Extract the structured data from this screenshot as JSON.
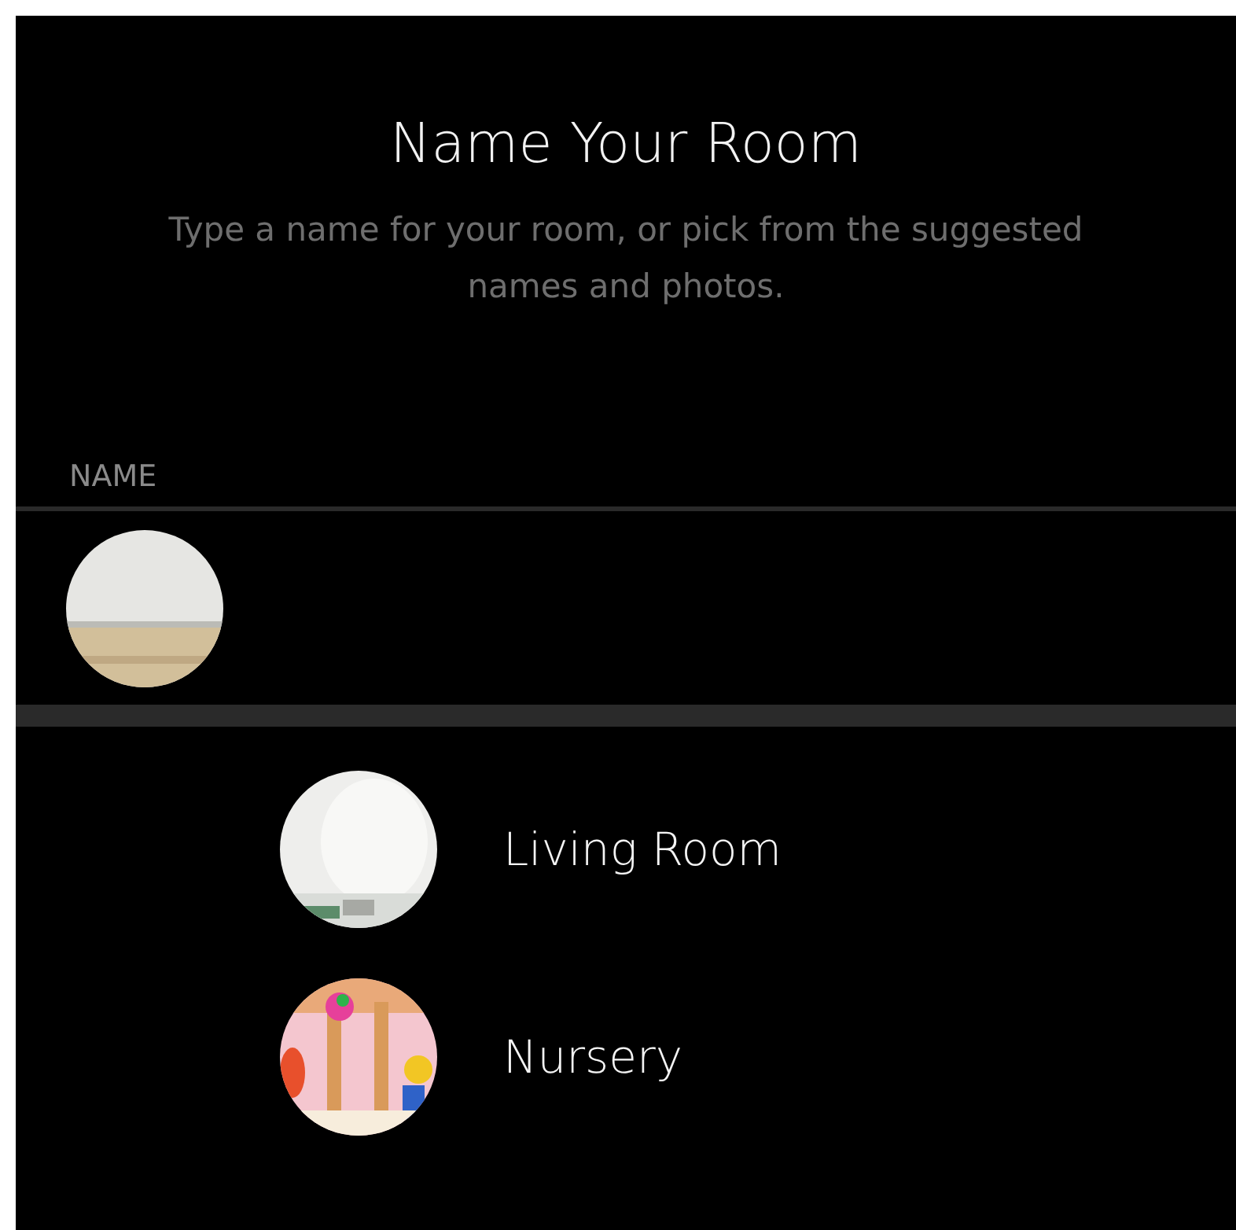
{
  "title": "Name Your Room",
  "subtitle": "Type a name for your room, or pick from the suggested names and photos.",
  "name_section": {
    "label": "NAME"
  },
  "suggestions": [
    {
      "label": "Living Room"
    },
    {
      "label": "Nursery"
    }
  ]
}
